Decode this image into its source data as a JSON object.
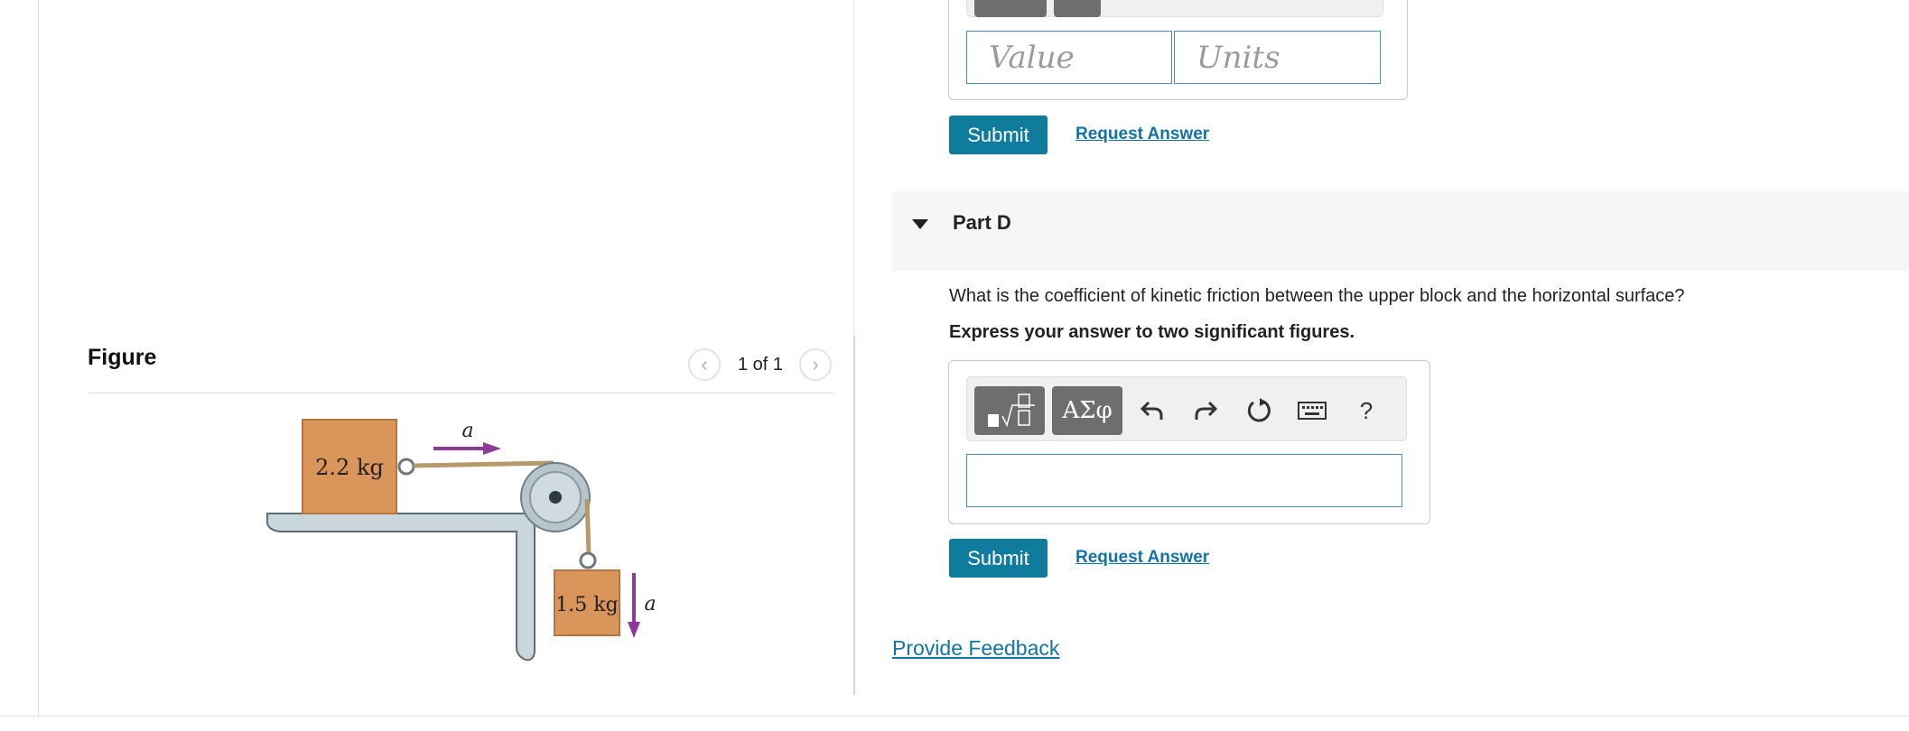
{
  "figure": {
    "title": "Figure",
    "pager": {
      "prev_icon": "chevron-left-icon",
      "text": "1 of 1",
      "next_icon": "chevron-right-icon"
    },
    "diagram": {
      "upper_block_label": "2.2 kg",
      "lower_block_label": "1.5 kg",
      "accel_label_top": "a",
      "accel_label_side": "a",
      "arrow_color": "#8e3a9b",
      "block_color": "#d9955a"
    }
  },
  "part_c": {
    "value_placeholder": "Value",
    "units_placeholder": "Units",
    "submit_label": "Submit",
    "request_answer_label": "Request Answer"
  },
  "part_d": {
    "title": "Part D",
    "question": "What is the coefficient of kinetic friction between the upper block and the horizontal surface?",
    "instruction": "Express your answer to two significant figures.",
    "toolbar": {
      "templates_icon": "templates-icon",
      "symbols_label": "ΑΣφ",
      "undo_icon": "undo-icon",
      "redo_icon": "redo-icon",
      "reset_icon": "reset-icon",
      "keyboard_icon": "keyboard-icon",
      "help_label": "?"
    },
    "answer_value": "",
    "submit_label": "Submit",
    "request_answer_label": "Request Answer"
  },
  "feedback_label": "Provide Feedback",
  "colors": {
    "accent": "#0f7c9e",
    "link": "#1274a5",
    "field_border": "#4b8fb5"
  }
}
